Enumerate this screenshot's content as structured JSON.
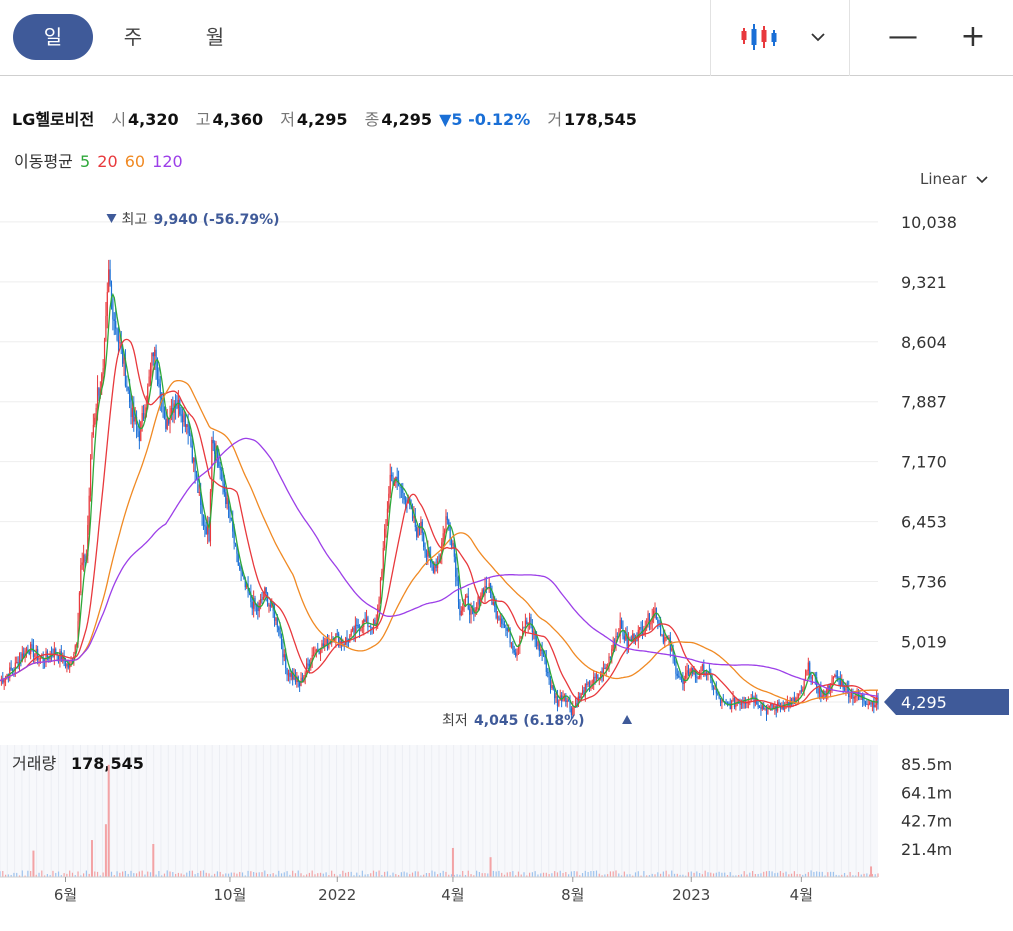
{
  "period_tabs": [
    {
      "label": "일",
      "active": true
    },
    {
      "label": "주",
      "active": false
    },
    {
      "label": "월",
      "active": false
    }
  ],
  "icons": {
    "chart_type": "candlestick-icon",
    "dropdown": "chevron-down-icon",
    "zoom_out": "minus-icon",
    "zoom_in": "plus-icon",
    "scale_dropdown": "chevron-down-icon",
    "high_marker": "triangle-down-icon",
    "low_marker": "triangle-up-icon"
  },
  "zoom_out_label": "—",
  "zoom_in_label": "+",
  "stock": {
    "name": "LG헬로비전",
    "open_label": "시",
    "open": "4,320",
    "high_label": "고",
    "high": "4,360",
    "low_label": "저",
    "low": "4,295",
    "close_label": "종",
    "close": "4,295",
    "change": "▼5 -0.12%",
    "volume_label": "거",
    "volume": "178,545"
  },
  "moving_average": {
    "label": "이동평균",
    "periods": [
      {
        "value": "5",
        "color": "#2ea83a"
      },
      {
        "value": "20",
        "color": "#e8393d"
      },
      {
        "value": "60",
        "color": "#f08a24"
      },
      {
        "value": "120",
        "color": "#9c3fe8"
      }
    ]
  },
  "scale_mode": "Linear",
  "volume_panel": {
    "label": "거래량",
    "value": "178,545"
  },
  "colors": {
    "accent": "#3f5a99",
    "up": "#e8393d",
    "down": "#1a6fd6",
    "ma5": "#2ea83a",
    "ma20": "#e8393d",
    "ma60": "#f08a24",
    "ma120": "#9c3fe8",
    "grid": "#eeeeee"
  },
  "chart_data": {
    "type": "line",
    "price_axis": {
      "ticks": [
        10038,
        9321,
        8604,
        7887,
        7170,
        6453,
        5736,
        5019
      ],
      "tick_labels": [
        "10,038",
        "9,321",
        "8,604",
        "7,887",
        "7,170",
        "6,453",
        "5,736",
        "5,019"
      ],
      "ylim": [
        3900,
        10300
      ]
    },
    "x_tick_labels": [
      "6월",
      "10월",
      "2022",
      "4월",
      "8월",
      "2023",
      "4월"
    ],
    "x_ticks": [
      47,
      165,
      242,
      325,
      411,
      496,
      575
    ],
    "x_range": [
      0,
      630
    ],
    "current_price": {
      "value": 4295,
      "label": "4,295"
    },
    "high_marker": {
      "index": 80,
      "value": 9940,
      "prefix": "최고",
      "label": "9,940 (-56.79%)"
    },
    "low_marker": {
      "index": 432,
      "value": 4045,
      "prefix": "최저",
      "label": "4,045 (6.18%)"
    },
    "close_series": {
      "x": [
        0,
        10,
        20,
        30,
        40,
        50,
        55,
        58,
        62,
        66,
        70,
        74,
        78,
        80,
        84,
        88,
        95,
        100,
        105,
        110,
        114,
        118,
        125,
        130,
        135,
        145,
        150,
        152,
        155,
        160,
        165,
        170,
        175,
        180,
        185,
        190,
        195,
        200,
        205,
        215,
        225,
        235,
        240,
        245,
        250,
        260,
        270,
        280,
        290,
        298,
        300,
        302,
        305,
        310,
        315,
        320,
        325,
        330,
        335,
        340,
        345,
        350,
        355,
        360,
        365,
        370,
        375,
        380,
        385,
        390,
        395,
        400,
        405,
        410,
        420,
        430,
        435,
        440,
        445,
        450,
        460,
        470,
        475,
        480,
        485,
        490,
        495,
        500,
        505,
        510,
        515,
        520,
        530,
        540,
        550,
        560,
        570,
        575,
        580,
        590,
        600,
        610,
        620,
        625,
        630
      ],
      "values": [
        4550,
        4700,
        4950,
        4800,
        4900,
        4700,
        5050,
        5900,
        6050,
        7500,
        8000,
        8200,
        9400,
        9100,
        8700,
        8400,
        7700,
        7500,
        7900,
        8500,
        8200,
        7600,
        7900,
        7800,
        7600,
        6500,
        6300,
        7500,
        7300,
        6900,
        6500,
        6000,
        5700,
        5500,
        5400,
        5600,
        5400,
        5200,
        4700,
        4500,
        4900,
        5000,
        5100,
        5000,
        5050,
        5250,
        5200,
        7000,
        6800,
        6400,
        6300,
        6500,
        6100,
        5900,
        6000,
        6500,
        6200,
        5400,
        5500,
        5300,
        5600,
        5700,
        5400,
        5300,
        5100,
        4900,
        5200,
        5250,
        5000,
        4850,
        4500,
        4300,
        4400,
        4200,
        4450,
        4600,
        4700,
        5000,
        5200,
        5000,
        5150,
        5400,
        5100,
        5000,
        4700,
        4500,
        4700,
        4600,
        4700,
        4550,
        4350,
        4250,
        4300,
        4350,
        4200,
        4250,
        4300,
        4400,
        4700,
        4350,
        4600,
        4400,
        4330,
        4295,
        4295
      ]
    },
    "series": [
      {
        "name": "5",
        "color": "#2ea83a",
        "window": 5
      },
      {
        "name": "20",
        "color": "#e8393d",
        "window": 20
      },
      {
        "name": "60",
        "color": "#f08a24",
        "window": 60
      },
      {
        "name": "120",
        "color": "#9c3fe8",
        "window": 120
      }
    ],
    "volume_axis": {
      "ticks": [
        85.5,
        64.1,
        42.7,
        21.4
      ],
      "tick_labels": [
        "85.5m",
        "64.1m",
        "42.7m",
        "21.4m"
      ],
      "ylim": [
        0,
        100
      ]
    },
    "volume_spikes": [
      {
        "x": 78,
        "value": 85
      },
      {
        "x": 76,
        "value": 40
      },
      {
        "x": 66,
        "value": 28
      },
      {
        "x": 110,
        "value": 25
      },
      {
        "x": 24,
        "value": 20
      },
      {
        "x": 325,
        "value": 22
      },
      {
        "x": 352,
        "value": 15
      },
      {
        "x": 625,
        "value": 8
      }
    ]
  }
}
